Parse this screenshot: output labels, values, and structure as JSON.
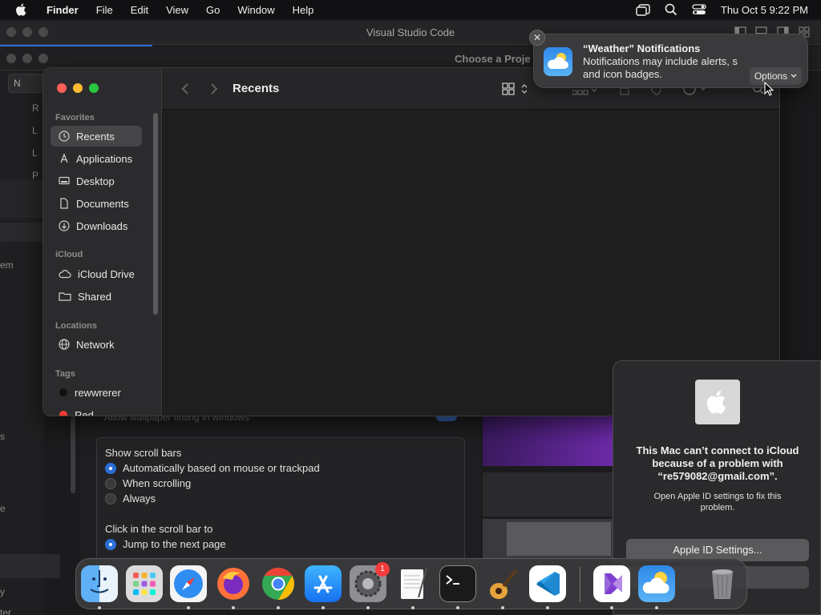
{
  "menubar": {
    "app": "Finder",
    "items": [
      "File",
      "Edit",
      "View",
      "Go",
      "Window",
      "Help"
    ],
    "clock": "Thu Oct 5  9:22 PM"
  },
  "background": {
    "vscode_title": "Visual Studio Code",
    "project_title": "Choose a Proje",
    "left_fragments": [
      "N",
      "R",
      "L",
      "L",
      "P",
      "em",
      "s",
      "e",
      "y",
      "ter"
    ],
    "settings": {
      "faint_row": "Allow wallpaper tinting in windows",
      "scroll_heading": "Show scroll bars",
      "scroll_options": [
        {
          "label": "Automatically based on mouse or trackpad",
          "selected": true
        },
        {
          "label": "When scrolling",
          "selected": false
        },
        {
          "label": "Always",
          "selected": false
        }
      ],
      "click_heading": "Click in the scroll bar to",
      "click_options": [
        {
          "label": "Jump to the next page",
          "selected": true
        }
      ]
    }
  },
  "finder": {
    "title": "Recents",
    "sidebar": {
      "favorites_label": "Favorites",
      "favorites": [
        "Recents",
        "Applications",
        "Desktop",
        "Documents",
        "Downloads"
      ],
      "icloud_label": "iCloud",
      "icloud": [
        "iCloud Drive",
        "Shared"
      ],
      "locations_label": "Locations",
      "locations": [
        "Network"
      ],
      "tags_label": "Tags",
      "tags": [
        {
          "name": "rewwrerer",
          "color": "#111111"
        },
        {
          "name": "Red",
          "color": "#ff3b30"
        }
      ]
    }
  },
  "notification": {
    "title": "“Weather” Notifications",
    "body": "Notifications may include alerts, s... and icon badges.",
    "body_line1": "Notifications may include alerts, s",
    "body_line2": "and icon badges.",
    "options_label": "Options"
  },
  "icloud_alert": {
    "message": "This Mac can’t connect to iCloud because of a problem with “re579082@gmail.com”.",
    "sub": "Open Apple ID settings to fix this problem.",
    "primary_button": "Apple ID Settings...",
    "secondary_button": ""
  },
  "dock": {
    "apps": [
      {
        "name": "finder",
        "running": true
      },
      {
        "name": "launchpad",
        "running": false
      },
      {
        "name": "safari",
        "running": true
      },
      {
        "name": "firefox",
        "running": true
      },
      {
        "name": "chrome",
        "running": true
      },
      {
        "name": "app-store",
        "running": true
      },
      {
        "name": "system-settings",
        "running": true,
        "badge": "1"
      },
      {
        "name": "textedit",
        "running": true
      },
      {
        "name": "terminal",
        "running": true
      },
      {
        "name": "garageband",
        "running": true
      },
      {
        "name": "vscode",
        "running": true
      },
      {
        "name": "visual-studio",
        "running": true
      },
      {
        "name": "weather",
        "running": true
      },
      {
        "name": "trash",
        "running": false
      }
    ]
  },
  "colors": {
    "accent": "#2b6fd6",
    "tag_black": "#111111",
    "tag_red": "#ff3b30"
  }
}
